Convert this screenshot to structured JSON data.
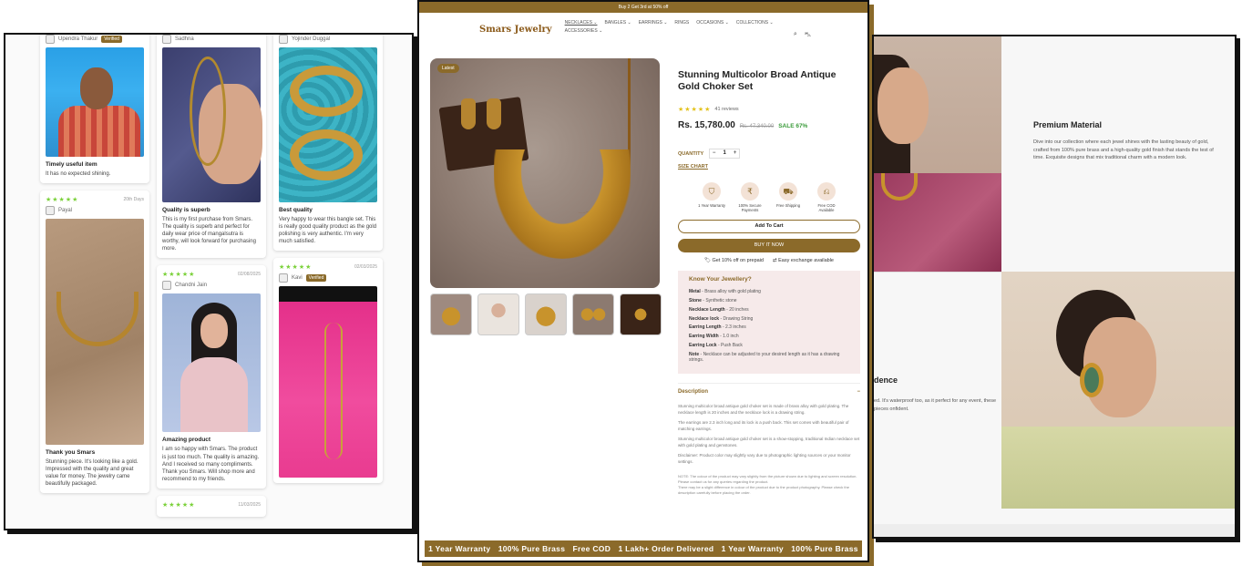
{
  "reviews": {
    "col1": [
      {
        "name": "Upendra Thakur",
        "verified": "Verified",
        "title": "Timely useful item",
        "text": "It has no expected shining."
      },
      {
        "name": "Payal",
        "stars": "★★★★★",
        "date": "20th Days",
        "title": "Thank you Smars",
        "text": "Stunning piece. It's looking like a gold. Impressed with the quality and great value for money. The jewelry came beautifully packaged."
      }
    ],
    "col2": [
      {
        "name": "Sadhna",
        "title": "Quality is superb",
        "text": "This is my first purchase from Smars. The quality is superb and perfect for daily wear price of mangalsutra is worthy, will look forward for purchasing more."
      },
      {
        "name": "Chandni Jain",
        "stars": "★★★★★",
        "date": "02/08/2025",
        "title": "Amazing product",
        "text": "I am so happy with Smars. The product is just too much. The quality is amazing. And I received so many compliments. Thank you Smars. Will shop more and recommend to my friends."
      },
      {
        "stars": "★★★★★",
        "date": "11/03/2025"
      }
    ],
    "col3": [
      {
        "name": "Yojinder Duggal",
        "title": "Best quality",
        "text": "Very happy to wear this bangle set. This is really good quality product as the gold polishing is very authentic. I'm very much satisfied."
      },
      {
        "name": "Kavi",
        "verified": "Verified",
        "stars": "★★★★★",
        "date": "02/03/2025"
      }
    ]
  },
  "product": {
    "announcement": "Buy 2 Get 3rd at 50% off",
    "brand": "Smars Jewelry",
    "nav": [
      "NECKLACES ⌄",
      "BANGLES ⌄",
      "EARRINGS ⌄",
      "RINGS",
      "OCCASIONS ⌄",
      "COLLECTIONS ⌄",
      "ACCESSORIES ⌄"
    ],
    "badge": "Latest",
    "title": "Stunning Multicolor Broad Antique Gold Choker Set",
    "stars": "★★★★★",
    "reviews": "41 reviews",
    "price": "Rs. 15,780.00",
    "compare_price": "Rs. 47,340.00",
    "sale": "SALE 67%",
    "quantity_label": "QUANTITY",
    "quantity_value": "1",
    "size_chart": "SIZE CHART",
    "features": [
      {
        "icon": "⛉",
        "label": "1 Year Warranty"
      },
      {
        "icon": "₹",
        "label": "100% Secure Payments"
      },
      {
        "icon": "⛟",
        "label": "Free Shipping"
      },
      {
        "icon": "⎌",
        "label": "Free COD Available"
      }
    ],
    "add_to_cart": "Add To Cart",
    "buy_now": "BUY IT NOW",
    "perks": [
      "🏷 Get 10% off on prepaid",
      "⇄ Easy exchange available"
    ],
    "know_title": "Know Your Jewellery?",
    "know_lines": [
      {
        "k": "Metal",
        "v": " - Brass alloy with gold plating"
      },
      {
        "k": "Stone",
        "v": " - Synthetic stone"
      },
      {
        "k": "Necklace Length",
        "v": " - 20 inches"
      },
      {
        "k": "Necklace lock",
        "v": " - Drawing String"
      },
      {
        "k": "Earring Length",
        "v": " - 2.3 inches"
      },
      {
        "k": "Earring Width",
        "v": " - 1.0 inch"
      },
      {
        "k": "Earring Lock",
        "v": " - Push Back"
      },
      {
        "k": "Note",
        "v": " - Necklace can be adjusted to your desired length as it has a drawing strings."
      }
    ],
    "description_label": "Description",
    "description": [
      "Stunning multicolor broad antique gold choker set is made of brass alloy with gold plating. The necklace length is 20 inches and the necklace lock is a drawing string.",
      "The earrings are 2.3 inch long and its lock is a push back. This set comes with beautiful pair of matching earrings.",
      "Stunning multicolor broad antique gold choker set is a show-stopping, traditional Indian necklace set with gold plating and gemstones.",
      "Disclaimer: Product color may slightly vary due to photographic lighting sources or your monitor settings."
    ],
    "note": "NOTE: The colour of the product may vary slightly from the picture shown due to lighting and screen resolution. Please contact us for any queries regarding the product.",
    "note2": "There may be a slight difference in colour of the product due to the product photography. Please check the description carefully before placing the order.",
    "marquee": [
      "1 Year Warranty",
      "100% Pure Brass",
      "Free COD",
      "1 Lakh+ Order Delivered",
      "1 Year Warranty",
      "100% Pure Brass"
    ]
  },
  "lifestyle": {
    "heading1": "Premium Material",
    "text1": "Dive into our collection where each jewel shines with the lasting beauty of gold, crafted from 100% pure brass and a high-quality gold finish that stands the test of time. Exquisite designs that mix traditional charm with a modern look.",
    "heading2": "dence",
    "text2": "ed. It's waterproof too, as it perfect for any event, these pieces onfident."
  }
}
